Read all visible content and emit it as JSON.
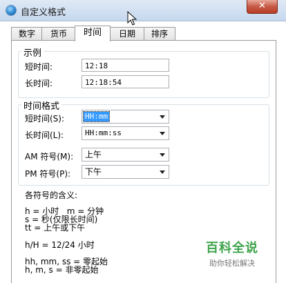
{
  "window": {
    "title": "自定义格式",
    "close_glyph": "✕"
  },
  "tabs": [
    {
      "label": "数字",
      "active": false
    },
    {
      "label": "货币",
      "active": false
    },
    {
      "label": "时间",
      "active": true
    },
    {
      "label": "日期",
      "active": false
    },
    {
      "label": "排序",
      "active": false
    }
  ],
  "example": {
    "title": "示例",
    "short_label": "短时间:",
    "short_value": "12:18",
    "long_label": "长时间:",
    "long_value": "12:18:54"
  },
  "time_format": {
    "title": "时间格式",
    "short_label": "短时间(S):",
    "short_value": "HH:mm",
    "long_label": "长时间(L):",
    "long_value": "HH:mm:ss",
    "am_label": "AM 符号(M):",
    "am_value": "上午",
    "pm_label": "PM 符号(P):",
    "pm_value": "下午"
  },
  "legend": {
    "heading": "各符号的含义:",
    "line1": "h = 小时   m = 分钟",
    "line2": "s = 秒(仅限长时间)",
    "line3": "tt = 上午或下午",
    "line4": "h/H = 12/24 小时",
    "line5": "hh, mm, ss = 零起始",
    "line6": "h, m, s = 非零起始"
  },
  "watermark": {
    "main": "百科全说",
    "sub": "助你轻松解决"
  },
  "icons": {
    "window": "globe-icon",
    "close": "close-icon",
    "cursor": "mouse-cursor-icon",
    "dropdown": "chevron-down-icon"
  }
}
